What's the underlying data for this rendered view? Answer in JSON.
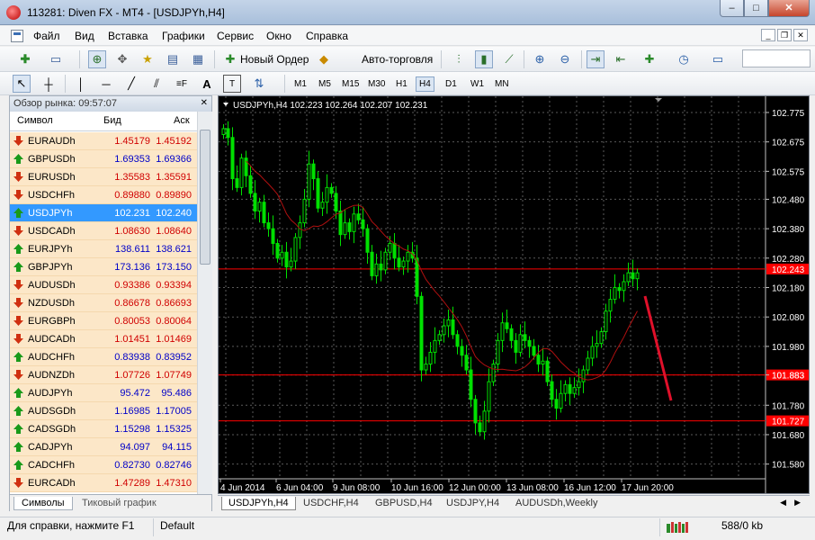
{
  "window": {
    "title": "113281: Diven FX - MT4 - [USDJPYh,H4]",
    "min": "–",
    "max": "□",
    "close": "✕"
  },
  "menu": {
    "items": [
      "Файл",
      "Вид",
      "Вставка",
      "Графики",
      "Сервис",
      "Окно",
      "Справка"
    ]
  },
  "toolbar": {
    "new_order": "Новый Ордер",
    "auto_trading": "Авто-торговля"
  },
  "timeframes": [
    "M1",
    "M5",
    "M15",
    "M30",
    "H1",
    "H4",
    "D1",
    "W1",
    "MN"
  ],
  "active_timeframe": "H4",
  "market_watch": {
    "title": "Обзор рынка: 09:57:07",
    "col_symbol": "Символ",
    "col_bid": "Бид",
    "col_ask": "Аск",
    "rows": [
      {
        "symbol": "EURAUDh",
        "bid": "1.45179",
        "ask": "1.45192",
        "dir": "down"
      },
      {
        "symbol": "GBPUSDh",
        "bid": "1.69353",
        "ask": "1.69366",
        "dir": "up"
      },
      {
        "symbol": "EURUSDh",
        "bid": "1.35583",
        "ask": "1.35591",
        "dir": "down"
      },
      {
        "symbol": "USDCHFh",
        "bid": "0.89880",
        "ask": "0.89890",
        "dir": "down"
      },
      {
        "symbol": "USDJPYh",
        "bid": "102.231",
        "ask": "102.240",
        "dir": "up",
        "selected": true
      },
      {
        "symbol": "USDCADh",
        "bid": "1.08630",
        "ask": "1.08640",
        "dir": "down"
      },
      {
        "symbol": "EURJPYh",
        "bid": "138.611",
        "ask": "138.621",
        "dir": "up"
      },
      {
        "symbol": "GBPJPYh",
        "bid": "173.136",
        "ask": "173.150",
        "dir": "up"
      },
      {
        "symbol": "AUDUSDh",
        "bid": "0.93386",
        "ask": "0.93394",
        "dir": "down"
      },
      {
        "symbol": "NZDUSDh",
        "bid": "0.86678",
        "ask": "0.86693",
        "dir": "down"
      },
      {
        "symbol": "EURGBPh",
        "bid": "0.80053",
        "ask": "0.80064",
        "dir": "down"
      },
      {
        "symbol": "AUDCADh",
        "bid": "1.01451",
        "ask": "1.01469",
        "dir": "down"
      },
      {
        "symbol": "AUDCHFh",
        "bid": "0.83938",
        "ask": "0.83952",
        "dir": "up"
      },
      {
        "symbol": "AUDNZDh",
        "bid": "1.07726",
        "ask": "1.07749",
        "dir": "down"
      },
      {
        "symbol": "AUDJPYh",
        "bid": "95.472",
        "ask": "95.486",
        "dir": "up"
      },
      {
        "symbol": "AUDSGDh",
        "bid": "1.16985",
        "ask": "1.17005",
        "dir": "up"
      },
      {
        "symbol": "CADSGDh",
        "bid": "1.15298",
        "ask": "1.15325",
        "dir": "up"
      },
      {
        "symbol": "CADJPYh",
        "bid": "94.097",
        "ask": "94.115",
        "dir": "up"
      },
      {
        "symbol": "CADCHFh",
        "bid": "0.82730",
        "ask": "0.82746",
        "dir": "up"
      },
      {
        "symbol": "EURCADh",
        "bid": "1.47289",
        "ask": "1.47310",
        "dir": "down"
      }
    ],
    "tab_symbols": "Символы",
    "tab_tick": "Тиковый график"
  },
  "chart": {
    "header": "USDJPYh,H4  102.223 102.264 102.207 102.231",
    "price_labels": [
      "102.775",
      "102.675",
      "102.575",
      "102.480",
      "102.380",
      "102.280",
      "102.180",
      "102.080",
      "101.980",
      "101.883",
      "101.780",
      "101.680",
      "101.580"
    ],
    "date_labels": [
      "4 Jun 2014",
      "6 Jun 04:00",
      "9 Jun 08:00",
      "10 Jun 16:00",
      "12 Jun 00:00",
      "13 Jun 08:00",
      "16 Jun 12:00",
      "17 Jun 20:00"
    ],
    "hlines": [
      {
        "price": "102.243",
        "color": "#ff0000"
      },
      {
        "price": "101.883",
        "color": "#ff0000"
      },
      {
        "price": "101.727",
        "color": "#ff0000"
      }
    ]
  },
  "chart_tabs": [
    "USDJPYh,H4",
    "USDCHF,H4",
    "GBPUSD,H4",
    "USDJPY,H4",
    "AUDUSDh,Weekly"
  ],
  "status": {
    "help": "Для справки, нажмите F1",
    "profile": "Default",
    "traffic": "588/0 kb"
  }
}
